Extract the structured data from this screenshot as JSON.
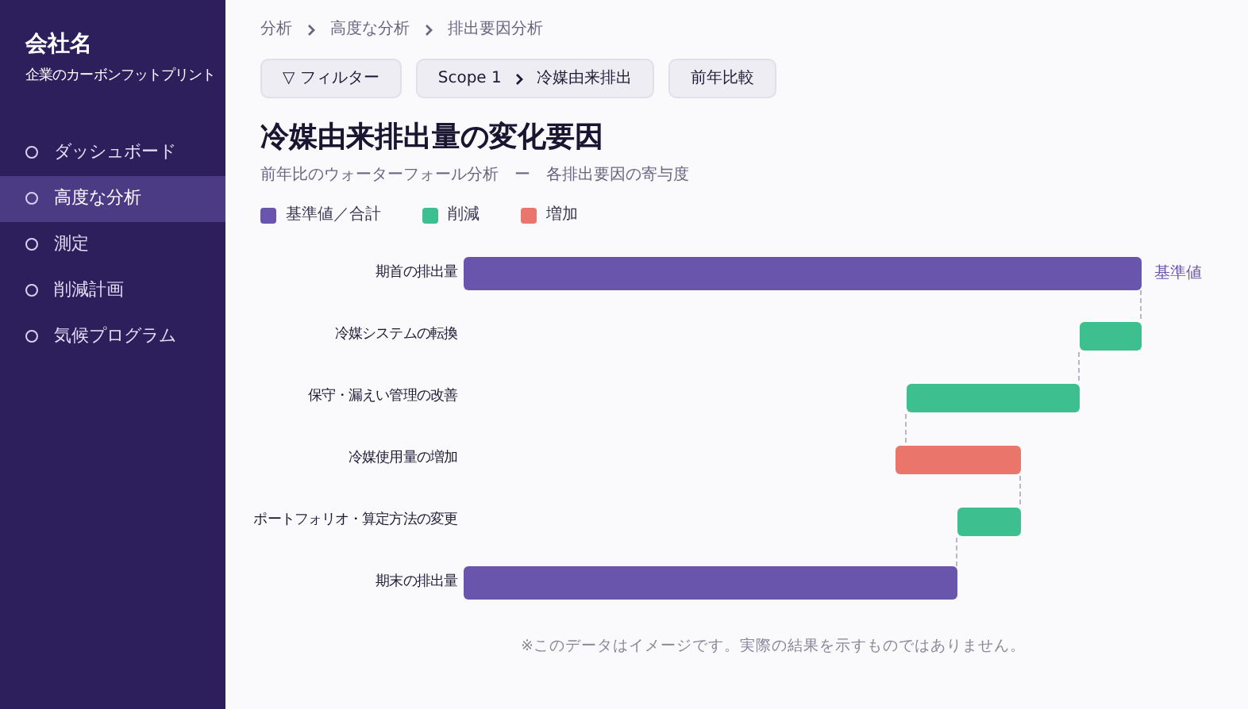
{
  "sidebar": {
    "company": "会社名",
    "subtitle": "企業のカーボンフットプリント",
    "items": [
      {
        "label": "ダッシュボード",
        "selected": false
      },
      {
        "label": "高度な分析",
        "selected": true
      },
      {
        "label": "測定",
        "selected": false
      },
      {
        "label": "削減計画",
        "selected": false
      },
      {
        "label": "気候プログラム",
        "selected": false
      }
    ]
  },
  "breadcrumb": [
    "分析",
    "高度な分析",
    "排出要因分析"
  ],
  "toolbar": {
    "filter": "▽ フィルター",
    "scope": [
      "Scope 1",
      "冷媒由来排出"
    ],
    "compare": "前年比較"
  },
  "title": "冷媒由来排出量の変化要因",
  "subtitle": "前年比のウォーターフォール分析　ー　各排出要因の寄与度",
  "legend": [
    {
      "label": "基準値／合計",
      "color": "#6a55ad"
    },
    {
      "label": "削減",
      "color": "#3dbf8f"
    },
    {
      "label": "増加",
      "color": "#ea756b"
    }
  ],
  "rows": [
    {
      "label": "期首の排出量",
      "kind": "base",
      "note": "基準値"
    },
    {
      "label": "冷媒システムの転換",
      "kind": "decrease"
    },
    {
      "label": "保守・漏えい管理の改善",
      "kind": "decrease"
    },
    {
      "label": "冷媒使用量の増加",
      "kind": "increase"
    },
    {
      "label": "ポートフォリオ・算定方法の変更",
      "kind": "decrease"
    },
    {
      "label": "期末の排出量",
      "kind": "base"
    }
  ],
  "footnote": "※このデータはイメージです。実際の結果を示すものではありません。"
}
